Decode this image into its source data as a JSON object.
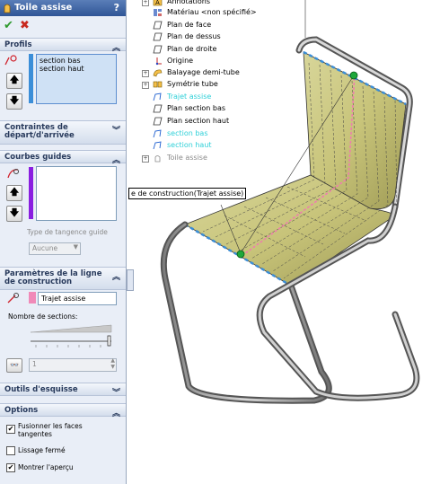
{
  "property_manager": {
    "title": "Toile assise",
    "help_glyph": "?",
    "ok_glyph": "✔",
    "cancel_glyph": "✖",
    "sections": {
      "profils": {
        "title": "Profils",
        "items": [
          "section bas",
          "section haut"
        ]
      },
      "contraintes": {
        "title": "Contraintes de départ/d'arrivée"
      },
      "courbes_guides": {
        "title": "Courbes guides",
        "tangency_label": "Type de tangence guide",
        "tangency_value": "Aucune"
      },
      "ligne_construction": {
        "title": "Paramètres de la ligne de construction",
        "path_value": "Trajet assise",
        "sections_label": "Nombre de sections:",
        "spin_value": "1"
      },
      "outils": {
        "title": "Outils d'esquisse"
      },
      "options": {
        "title": "Options",
        "opt1": "Fusionner les faces tangentes",
        "opt1_checked": true,
        "opt2": "Lissage fermé",
        "opt2_checked": false,
        "opt3": "Montrer l'aperçu",
        "opt3_checked": true
      }
    }
  },
  "feature_tree": {
    "items": [
      {
        "label": "Annotations",
        "icon": "annotations-icon"
      },
      {
        "label": "Matériau <non spécifié>",
        "icon": "material-icon"
      },
      {
        "label": "Plan de face",
        "icon": "plane-icon"
      },
      {
        "label": "Plan de dessus",
        "icon": "plane-icon"
      },
      {
        "label": "Plan de droite",
        "icon": "plane-icon"
      },
      {
        "label": "Origine",
        "icon": "origin-icon"
      },
      {
        "label": "Balayage demi-tube",
        "icon": "sweep-icon"
      },
      {
        "label": "Symétrie tube",
        "icon": "mirror-icon"
      },
      {
        "label": "Trajet assise",
        "icon": "sketch-icon"
      },
      {
        "label": "Plan section bas",
        "icon": "plane-icon"
      },
      {
        "label": "Plan section haut",
        "icon": "plane-icon"
      },
      {
        "label": "section bas",
        "icon": "sketch-icon"
      },
      {
        "label": "section haut",
        "icon": "sketch-icon"
      },
      {
        "label": "Toile assise",
        "icon": "loft-icon"
      }
    ]
  },
  "viewport": {
    "callout": "e de construction(Trajet assise)"
  }
}
